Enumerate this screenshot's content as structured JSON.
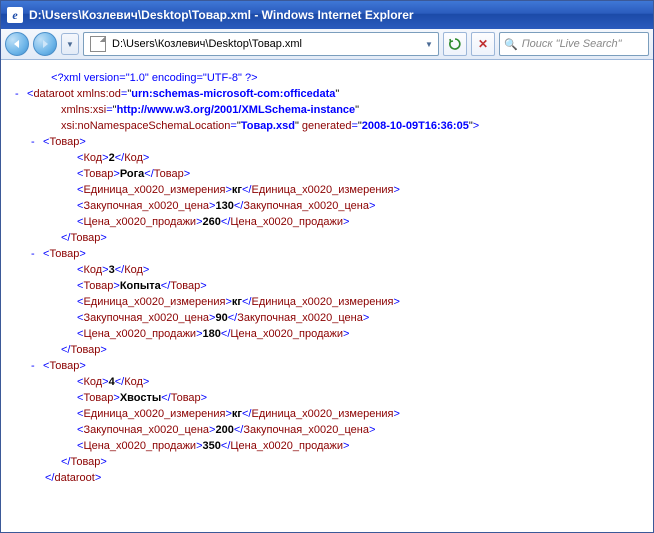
{
  "window": {
    "title": "D:\\Users\\Козлевич\\Desktop\\Товар.xml - Windows Internet Explorer"
  },
  "nav": {
    "address": "D:\\Users\\Козлевич\\Desktop\\Товар.xml",
    "search_placeholder": "Поиск \"Live Search\""
  },
  "xml": {
    "declaration": "<?xml version=\"1.0\" encoding=\"UTF-8\" ?>",
    "root_tag": "dataroot",
    "root_attrs": [
      {
        "name": "xmlns:od",
        "value": "urn:schemas-microsoft-com:officedata"
      },
      {
        "name": "xmlns:xsi",
        "value": "http://www.w3.org/2001/XMLSchema-instance"
      },
      {
        "name": "xsi:noNamespaceSchemaLocation",
        "value": "Товар.xsd"
      },
      {
        "name": "generated",
        "value": "2008-10-09T16:36:05"
      }
    ],
    "item_tag": "Товар",
    "field_tags": {
      "code": "Код",
      "name": "Товар",
      "unit": "Единица_x0020_измерения",
      "buy": "Закупочная_x0020_цена",
      "sell": "Цена_x0020_продажи"
    },
    "items": [
      {
        "code": "2",
        "name": "Рога",
        "unit": "кг",
        "buy": "130",
        "sell": "260"
      },
      {
        "code": "3",
        "name": "Копыта",
        "unit": "кг",
        "buy": "90",
        "sell": "180"
      },
      {
        "code": "4",
        "name": "Хвосты",
        "unit": "кг",
        "buy": "200",
        "sell": "350"
      }
    ]
  }
}
